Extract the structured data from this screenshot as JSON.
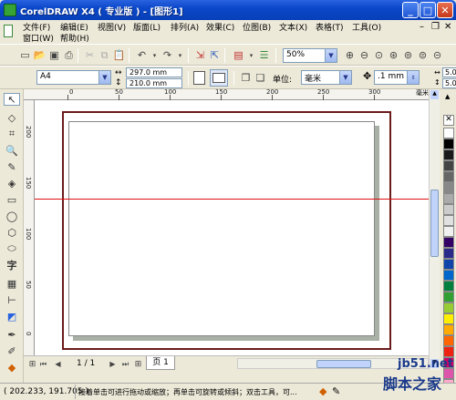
{
  "window": {
    "title": "CorelDRAW X4 ( 专业版 ) - [图形1]"
  },
  "menubar": {
    "row1": [
      "文件(F)",
      "编辑(E)",
      "视图(V)",
      "版面(L)",
      "排列(A)",
      "效果(C)",
      "位图(B)",
      "文本(X)",
      "表格(T)",
      "工具(O)"
    ],
    "row2": [
      "窗口(W)",
      "帮助(H)"
    ]
  },
  "standard_toolbar": {
    "zoom_value": "50%"
  },
  "property_bar": {
    "paper_size": "A4",
    "width": "297.0 mm",
    "height": "210.0 mm",
    "unit_label": "单位:",
    "unit_value": "毫米",
    "nudge_value": ".1 mm",
    "dup_x": "5.0",
    "dup_y": "5.0"
  },
  "ruler": {
    "top_labels": [
      "0",
      "50",
      "100",
      "150",
      "200",
      "250",
      "300"
    ],
    "left_labels": [
      "200",
      "150",
      "100",
      "50",
      "0"
    ]
  },
  "page_nav": {
    "page_count": "1 / 1",
    "page_tab": "页 1"
  },
  "status": {
    "coords": "( 202.233, 191.705 )",
    "hint": "接着单击可进行拖动或缩放；再单击可旋转或倾斜；双击工具，可..."
  },
  "watermark": {
    "site": "jb51.net",
    "name": "脚本之家"
  },
  "colors": {
    "titlebar": "#0a47c9",
    "page_border": "#6b1a1a",
    "guide": "#e01010",
    "page_shadow": "#a9b0a6"
  },
  "palette": [
    "#ffffff",
    "#000000",
    "#1a1a1a",
    "#444444",
    "#666666",
    "#888888",
    "#aaaaaa",
    "#cccccc",
    "#e0e0e0",
    "#f0f0f0",
    "#330066",
    "#2a2a8a",
    "#1144aa",
    "#0066cc",
    "#007f3f",
    "#33a033",
    "#99cc33",
    "#ffee00",
    "#ffaa00",
    "#ff6600",
    "#ee2211",
    "#cc0066",
    "#dd55aa",
    "#ffaacc"
  ]
}
